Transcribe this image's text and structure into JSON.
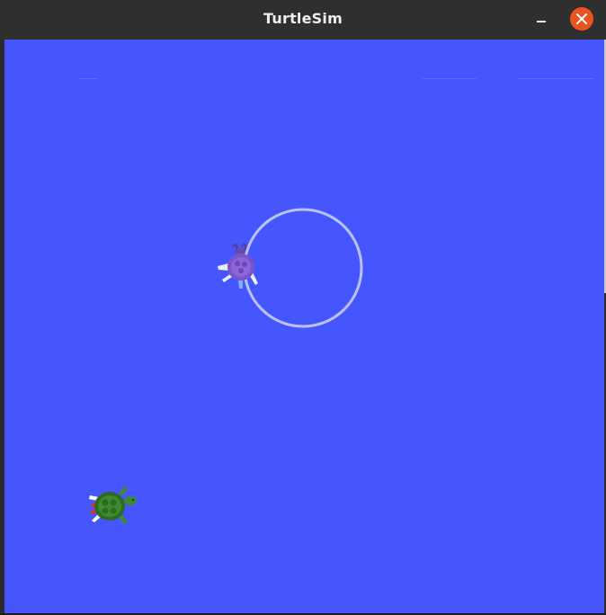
{
  "window": {
    "title": "TurtleSim"
  },
  "controls": {
    "minimize_icon": "minimize-icon",
    "close_icon": "close-icon"
  },
  "colors": {
    "canvas_background": "#4556ff",
    "titlebar": "#2f2f2f",
    "close_button": "#e95420",
    "trail": "#c9cdf2"
  },
  "turtles": [
    {
      "name": "turtle-purple",
      "shell_color": "#7a55c8"
    },
    {
      "name": "turtle-green",
      "shell_color": "#3a7a2a"
    }
  ]
}
